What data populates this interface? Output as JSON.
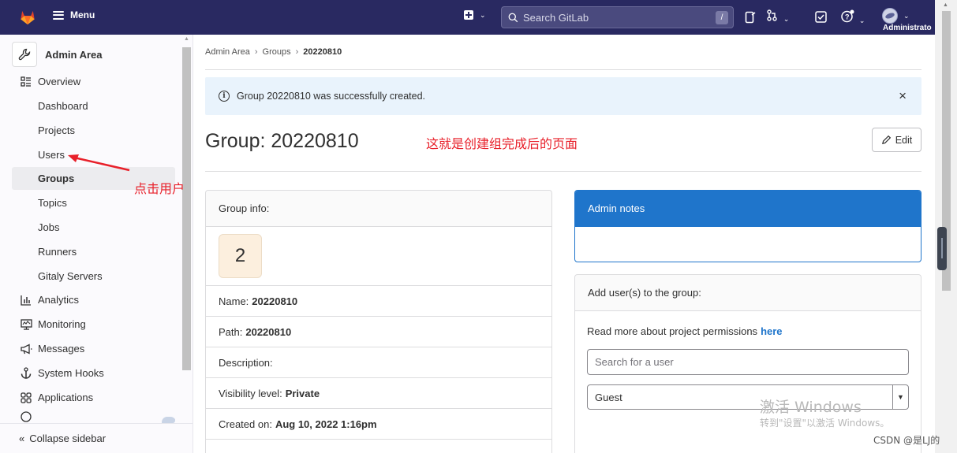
{
  "navbar": {
    "menu_label": "Menu",
    "search_placeholder": "Search GitLab",
    "search_shortcut": "/",
    "username": "Administrato"
  },
  "sidebar": {
    "header": "Admin Area",
    "overview_label": "Overview",
    "sub_items": [
      "Dashboard",
      "Projects",
      "Users",
      "Groups",
      "Topics",
      "Jobs",
      "Runners",
      "Gitaly Servers"
    ],
    "active_item": "Groups",
    "sections": [
      "Analytics",
      "Monitoring",
      "Messages",
      "System Hooks",
      "Applications"
    ],
    "collapse_label": "Collapse sidebar",
    "collapse_chevrons": "«"
  },
  "annotations": {
    "users_hint": "点击用户",
    "page_hint": "这就是创建组完成后的页面"
  },
  "breadcrumb": {
    "items": [
      "Admin Area",
      "Groups",
      "20220810"
    ],
    "separator": "›"
  },
  "alert": {
    "message": "Group 20220810 was successfully created.",
    "close_glyph": "×"
  },
  "page": {
    "title": "Group: 20220810",
    "edit_label": "Edit"
  },
  "group_info": {
    "header": "Group info:",
    "avatar_letter": "2",
    "fields": [
      {
        "label": "Name:",
        "value": "20220810"
      },
      {
        "label": "Path:",
        "value": "20220810"
      },
      {
        "label": "Description:",
        "value": ""
      },
      {
        "label": "Visibility level:",
        "value": "Private"
      },
      {
        "label": "Created on:",
        "value": "Aug 10, 2022 1:16pm"
      }
    ]
  },
  "admin_notes": {
    "header": "Admin notes"
  },
  "add_users": {
    "header": "Add user(s) to the group:",
    "permissions_text": "Read more about project permissions",
    "permissions_link": "here",
    "search_placeholder": "Search for a user",
    "role_selected": "Guest"
  },
  "watermark": {
    "line1": "激活 Windows",
    "line2": "转到\"设置\"以激活 Windows。",
    "credit": "CSDN @是LJ的"
  },
  "colors": {
    "navbar": "#292961",
    "accent": "#1f75cb",
    "alert_bg": "#e9f3fc",
    "annotation": "#e8202a"
  }
}
